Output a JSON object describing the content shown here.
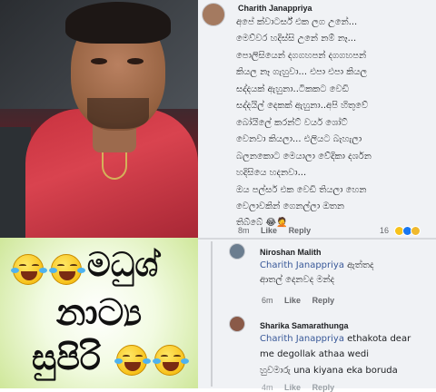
{
  "meme": {
    "line1": "මධුශ්",
    "line2": "නාට්‍ය",
    "line3": "සුපිරි"
  },
  "comment_main": {
    "author": "Charith Janappriya",
    "lines": [
      "අපේ ක්වාටර්ස් එක ලග උනේ...",
      "මෙව්වර හදිස්සි උනේ නම් නෑ...",
      "පොලිසියෙන් දගගහපන් දගගහපන්",
      "කියල නෑ ගැහුවා... එපා එපා කියල",
      "සද්දයක් ඇහුනා..ටිකකට වෙඩි",
      "සද්දයිල් දෙකක් ඇහුනා..අපි හිතුවේ",
      "බෝයිලේ කරන්ට් වයර් ශෝට්",
      "වෙනවා කියලා... එලියට බැහැලා",
      "බලනකොට මෙයාලා වේදිකා දර්ශන",
      "හදිසියෙ හදනවා...",
      "",
      "ඔය පල්සර් එක වෙඩි තියලා හෙන",
      "වෙලාවකින් ගෙනල්ලා ඔතන",
      "තිබ්බේ 😂🤦"
    ],
    "time": "8m",
    "like_label": "Like",
    "reply_label": "Reply",
    "reaction_count": "16"
  },
  "reply1": {
    "author": "Niroshan Malith",
    "mention": "Charith Janappriya",
    "text_after_mention": " ඇත්තද",
    "line2": "ආතල් දෙනවද මන්ද",
    "time": "6m",
    "like_label": "Like",
    "reply_label": "Reply"
  },
  "reply2": {
    "author": "Sharika Samarathunga",
    "mention": "Charith Janappriya",
    "text_after_mention": " ethakota dear",
    "line2": "me degollak athaa  wedi",
    "line3": "හුවමාරු una kiyana eka boruda",
    "time": "4m",
    "like_label": "Like",
    "reply_label": "Reply"
  },
  "colors": {
    "meme_bg": "#cfe79a",
    "comments_bg": "#f0f2f5",
    "mention": "#385898",
    "shirt": "#d9434f"
  }
}
